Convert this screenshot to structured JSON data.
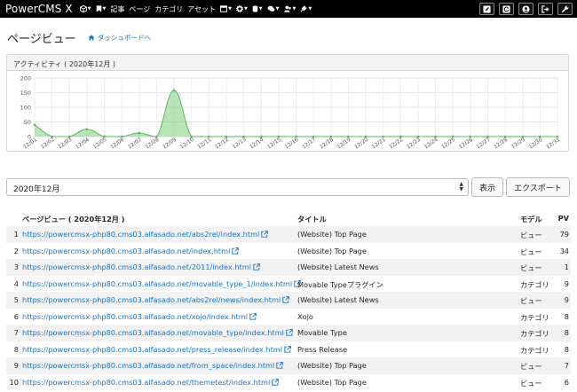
{
  "app": {
    "title": "PowerCMS X"
  },
  "nav": {
    "items": [
      {
        "icon": "cube-icon",
        "dropdown": true
      },
      {
        "icon": "bookmark-icon",
        "dropdown": true
      },
      {
        "label": "記事"
      },
      {
        "label": "ページ"
      },
      {
        "label": "カテゴリ"
      },
      {
        "label": "アセット"
      },
      {
        "icon": "window-icon",
        "dropdown": true
      },
      {
        "icon": "gear-icon",
        "dropdown": true
      },
      {
        "icon": "database-icon",
        "dropdown": true
      },
      {
        "icon": "comments-icon",
        "dropdown": true
      },
      {
        "icon": "users-icon",
        "dropdown": true
      },
      {
        "icon": "plug-icon",
        "dropdown": true
      }
    ],
    "right_buttons": [
      "edit-icon",
      "refresh-icon",
      "user-circle-icon",
      "sign-out-icon",
      "wrench-icon"
    ]
  },
  "page": {
    "title": "ページビュー",
    "dashboard_link": "ダッシュボードへ"
  },
  "activity": {
    "heading": "アクティビティ ( 2020年12月 )",
    "accent": "#7ccf7c"
  },
  "chart_data": {
    "type": "area",
    "title": "アクティビティ ( 2020年12月 )",
    "x": [
      "12/01",
      "12/02",
      "12/03",
      "12/04",
      "12/05",
      "12/06",
      "12/07",
      "12/08",
      "12/09",
      "12/10",
      "12/11",
      "12/12",
      "12/13",
      "12/14",
      "12/15",
      "12/16",
      "12/17",
      "12/18",
      "12/19",
      "12/20",
      "12/21",
      "12/22",
      "12/23",
      "12/24",
      "12/25",
      "12/26",
      "12/27",
      "12/28",
      "12/29",
      "12/30",
      "12/31"
    ],
    "values": [
      40,
      0,
      0,
      25,
      0,
      0,
      12,
      0,
      158,
      0,
      0,
      0,
      0,
      0,
      0,
      0,
      0,
      0,
      0,
      0,
      0,
      0,
      0,
      0,
      0,
      0,
      0,
      0,
      0,
      0,
      0
    ],
    "ylim": [
      0,
      200
    ],
    "yticks": [
      0,
      50,
      100,
      150,
      200
    ],
    "grid": true,
    "color": "#7ccf7c"
  },
  "controls": {
    "month_value": "2020年12月",
    "show_button": "表示",
    "export_button": "エクスポート"
  },
  "table": {
    "headers": {
      "url": "ページビュー ( 2020年12月 )",
      "title": "タイトル",
      "model": "モデル",
      "pv": "PV"
    },
    "rows": [
      {
        "n": "1",
        "url": "https://powercmsx-php80.cms03.alfasado.net/abs2rel/index.html",
        "title": "(Website) Top Page",
        "model": "ビュー",
        "pv": "79"
      },
      {
        "n": "2",
        "url": "https://powercmsx-php80.cms03.alfasado.net/index.html",
        "title": "(Website) Top Page",
        "model": "ビュー",
        "pv": "34"
      },
      {
        "n": "3",
        "url": "https://powercmsx-php80.cms03.alfasado.net/2011/index.html",
        "title": "(Website) Latest News",
        "model": "ビュー",
        "pv": "1"
      },
      {
        "n": "4",
        "url": "https://powercmsx-php80.cms03.alfasado.net/movable_type_1/index.html",
        "title": "Movable Typeプラグイン",
        "model": "カテゴリ",
        "pv": "9"
      },
      {
        "n": "5",
        "url": "https://powercmsx-php80.cms03.alfasado.net/abs2rel/news/index.html",
        "title": "(Website) Latest News",
        "model": "ビュー",
        "pv": "9"
      },
      {
        "n": "6",
        "url": "https://powercmsx-php80.cms03.alfasado.net/xojo/index.html",
        "title": "Xojo",
        "model": "カテゴリ",
        "pv": "8"
      },
      {
        "n": "7",
        "url": "https://powercmsx-php80.cms03.alfasado.net/movable_type/index.html",
        "title": "Movable Type",
        "model": "カテゴリ",
        "pv": "8"
      },
      {
        "n": "8",
        "url": "https://powercmsx-php80.cms03.alfasado.net/press_release/index.html",
        "title": "Press Release",
        "model": "カテゴリ",
        "pv": "8"
      },
      {
        "n": "9",
        "url": "https://powercmsx-php80.cms03.alfasado.net/from_space/index.html",
        "title": "(Website) Top Page",
        "model": "ビュー",
        "pv": "7"
      },
      {
        "n": "10",
        "url": "https://powercmsx-php80.cms03.alfasado.net/themetest/index.html",
        "title": "(Website) Top Page",
        "model": "ビュー",
        "pv": "6"
      }
    ]
  }
}
